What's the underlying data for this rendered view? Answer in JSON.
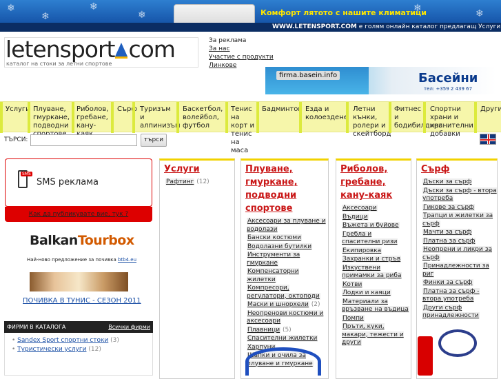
{
  "header": {
    "promo": "Комфорт лятото с нашите климатици",
    "ticker_site": "WWW.LETENSPORT.COM",
    "ticker_text": " е голям онлайн каталог предлагащ Услуги, Плуване",
    "logo": "letensport com",
    "tagline": "каталог на стоки за летни спортове",
    "links": [
      "За реклама",
      "За нас",
      "Участие с продукти",
      "Линкове"
    ]
  },
  "banner": {
    "url": "firma.basein.info",
    "title": "Басейни",
    "tel": "тел: +359 2 439 67"
  },
  "nav": [
    "Услуги",
    "Плуване, гмуркане, подводни спортове",
    "Риболов, гребане, кану-каяк",
    "Сърф",
    "Туризъм и алпинизъм",
    "Баскетбол, волейбол, футбол",
    "Тенис на корт и тенис на маса",
    "Бадминтон",
    "Езда и колоездене",
    "Летни кънки, ролери и скейтборд",
    "Фитнес и бодибилдинг",
    "Спортни храни и хранителни добавки",
    "Други"
  ],
  "search": {
    "label": "ТЪРСИ:",
    "button": "търси"
  },
  "sms": {
    "badge": "SMS",
    "text": "SMS реклама",
    "link": "Как да публикувате вие, тук ?"
  },
  "balkantour": {
    "brand1": "Balkan",
    "brand2": "Tourbox",
    "sub": "Най-ново предложение за почивка ",
    "sub_link": "btb4.eu",
    "link": "ПОЧИВКА В ТУНИС - СЕЗОН 2011"
  },
  "firms": {
    "title": "ФИРМИ В КАТАЛОГА",
    "all": "Всички фирми",
    "items": [
      {
        "name": "Sandex Sport спортни стоки",
        "count": "(3)"
      },
      {
        "name": "Туристически услуги",
        "count": "(12)"
      }
    ]
  },
  "columns": [
    {
      "title": "Услуги",
      "items": [
        {
          "name": "Рафтинг",
          "count": "(12)"
        }
      ]
    },
    {
      "title": "Плуване, гмуркане, подводни спортове",
      "items": [
        {
          "name": "Аксесоари за плуване и водолази",
          "count": ""
        },
        {
          "name": "Бански костюми",
          "count": ""
        },
        {
          "name": "Водолазни бутилки",
          "count": ""
        },
        {
          "name": "Инструменти за гмуркане",
          "count": ""
        },
        {
          "name": "Компенсаторни жилетки",
          "count": ""
        },
        {
          "name": "Компресори, регулатори, октоподи",
          "count": ""
        },
        {
          "name": "Маски и шнорхели",
          "count": "(2)"
        },
        {
          "name": "Неопренови костюми и аксесоари",
          "count": ""
        },
        {
          "name": "Плавници",
          "count": "(5)"
        },
        {
          "name": "Спасителни жилетки",
          "count": ""
        },
        {
          "name": "Харпуни",
          "count": ""
        },
        {
          "name": "Шапки и очила за плуване и гмуркане",
          "count": ""
        }
      ]
    },
    {
      "title": "Риболов, гребане, кану-каяк",
      "items": [
        {
          "name": "Аксесоари",
          "count": ""
        },
        {
          "name": "Въдици",
          "count": ""
        },
        {
          "name": "Въжета и буйове",
          "count": ""
        },
        {
          "name": "Гребла и спасителни ризи",
          "count": ""
        },
        {
          "name": "Екипировка",
          "count": ""
        },
        {
          "name": "Захранки и стръв",
          "count": ""
        },
        {
          "name": "Изкуствени примамки за риба",
          "count": ""
        },
        {
          "name": "Котви",
          "count": ""
        },
        {
          "name": "Лодки и каяци",
          "count": ""
        },
        {
          "name": "Материали за връзване на въдица",
          "count": ""
        },
        {
          "name": "Помпи",
          "count": ""
        },
        {
          "name": "Пръти, куки, макари, тежести и други",
          "count": ""
        }
      ]
    },
    {
      "title": "Сърф",
      "items": [
        {
          "name": "Дъски за сърф",
          "count": ""
        },
        {
          "name": "Дъски за сърф - втора употреба",
          "count": ""
        },
        {
          "name": "Гикове за сърф",
          "count": ""
        },
        {
          "name": "Трапци и жилетки за сърф",
          "count": ""
        },
        {
          "name": "Мачти за сърф",
          "count": ""
        },
        {
          "name": "Платна за сърф",
          "count": ""
        },
        {
          "name": "Неопрени и ликри за сърф",
          "count": ""
        },
        {
          "name": "Принадлежности за риг",
          "count": ""
        },
        {
          "name": "Финки за сърф",
          "count": ""
        },
        {
          "name": "Платна за сърф - втора употреба",
          "count": ""
        },
        {
          "name": "Други сърф принадлежности",
          "count": ""
        }
      ]
    }
  ]
}
